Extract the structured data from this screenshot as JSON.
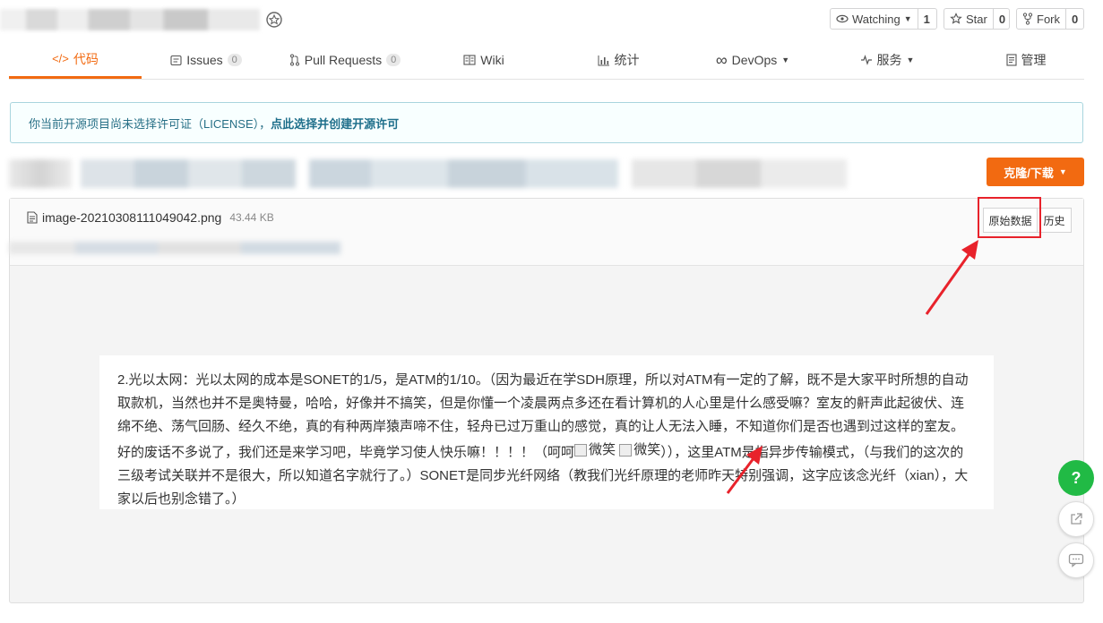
{
  "header": {
    "watch_label": "Watching",
    "watch_count": "1",
    "star_label": "Star",
    "star_count": "0",
    "fork_label": "Fork",
    "fork_count": "0"
  },
  "tabs": [
    {
      "label": "代码",
      "icon": "code-icon",
      "active": true
    },
    {
      "label": "Issues",
      "badge": "0",
      "icon": "issues-icon"
    },
    {
      "label": "Pull Requests",
      "badge": "0",
      "icon": "pull-request-icon"
    },
    {
      "label": "Wiki",
      "icon": "book-icon"
    },
    {
      "label": "统计",
      "icon": "bar-chart-icon"
    },
    {
      "label": "DevOps",
      "icon": "infinity-icon",
      "dropdown": true
    },
    {
      "label": "服务",
      "icon": "pulse-icon",
      "dropdown": true
    },
    {
      "label": "管理",
      "icon": "document-icon"
    }
  ],
  "notice": {
    "text": "你当前开源项目尚未选择许可证（LICENSE），",
    "link": "点此选择并创建开源许可"
  },
  "clone_button": "克隆/下载",
  "file": {
    "name": "image-20210308111049042.png",
    "size": "43.44 KB",
    "raw_button": "原始数据",
    "history_button": "历史"
  },
  "content": {
    "text_before": "2.光以太网：光以太网的成本是SONET的1/5，是ATM的1/10。（因为最近在学SDH原理，所以对ATM有一定的了解，既不是大家平时所想的自动取款机，当然也并不是奥特曼，哈哈，好像并不搞笑，但是你懂一个凌晨两点多还在看计算机的人心里是什么感受嘛？室友的鼾声此起彼伏、连绵不绝、荡气回肠、经久不绝，真的有种两岸猿声啼不住，轻舟已过万重山的感觉，真的让人无法入睡，不知道你们是否也遇到过这样的室友。好的废话不多说了，我们还是来学习吧，毕竟学习使人快乐嘛！！！！（呵呵",
    "emoji1_alt": "微笑",
    "emoji2_alt": "微笑",
    "text_after": "）），这里ATM是指异步传输模式，（与我们的这次的三级考试关联并不是很大，所以知道名字就行了。）SONET是同步光纤网络（教我们光纤原理的老师昨天特别强调，这字应该念光纤（xian），大家以后也别念错了。）"
  },
  "float_buttons": {
    "help_label": "?"
  },
  "colors": {
    "accent": "#f26a11",
    "notice_border": "#a9d5de",
    "help_green": "#21ba45",
    "annotation_red": "#e8222b"
  }
}
